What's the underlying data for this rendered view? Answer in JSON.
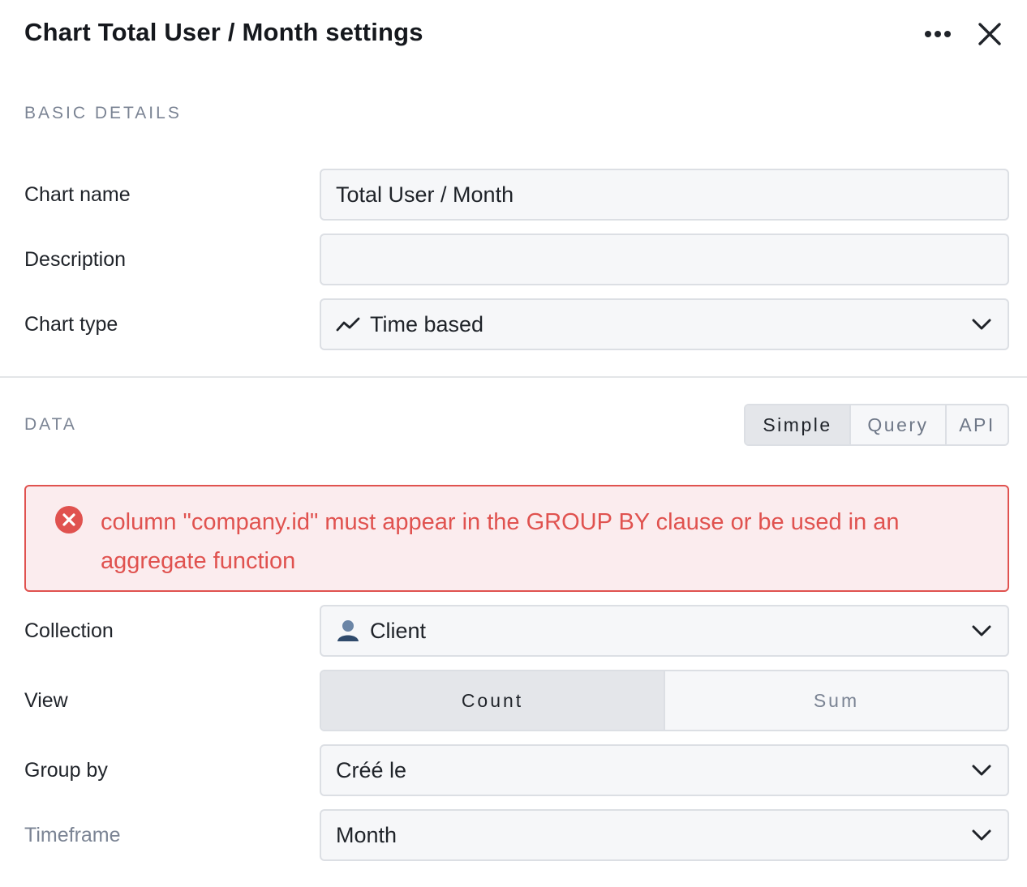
{
  "header": {
    "title": "Chart Total User / Month settings",
    "more_icon": "more-horizontal-icon",
    "close_icon": "close-icon"
  },
  "basic_details": {
    "section_label": "BASIC DETAILS",
    "chart_name": {
      "label": "Chart name",
      "value": "Total User / Month"
    },
    "description": {
      "label": "Description",
      "value": ""
    },
    "chart_type": {
      "label": "Chart type",
      "icon": "trend-line-icon",
      "value": "Time based"
    }
  },
  "data": {
    "section_label": "DATA",
    "modes": [
      "Simple",
      "Query",
      "API"
    ],
    "active_mode": "Simple",
    "error": {
      "icon": "error-circle-icon",
      "message": "column \"company.id\" must appear in the GROUP BY clause or be used in an aggregate function"
    },
    "collection": {
      "label": "Collection",
      "icon": "user-icon",
      "value": "Client"
    },
    "view": {
      "label": "View",
      "options": [
        "Count",
        "Sum"
      ],
      "active": "Count"
    },
    "group_by": {
      "label": "Group by",
      "value": "Créé le"
    },
    "timeframe": {
      "label": "Timeframe",
      "value": "Month"
    }
  },
  "colors": {
    "error": "#e0524f",
    "error_bg": "#fbecee",
    "muted": "#7b8494",
    "input_bg": "#f6f7f9",
    "border": "#dcdfe4"
  }
}
